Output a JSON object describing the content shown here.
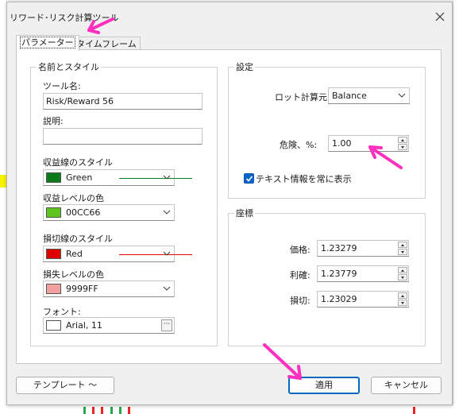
{
  "window": {
    "title": "リワード･リスク計算ツール"
  },
  "tabs": [
    {
      "label": "パラメーター",
      "active": true
    },
    {
      "label": "タイムフレーム",
      "active": false
    }
  ],
  "name_style": {
    "legend": "名前とスタイル",
    "tool_name_label": "ツール名:",
    "tool_name_value": "Risk/Reward 56",
    "description_label": "説明:",
    "description_value": "",
    "profit_line_label": "収益線のスタイル",
    "profit_line_color_name": "Green",
    "profit_line_color": "#0b7a1a",
    "profit_level_label": "収益レベルの色",
    "profit_level_color_name": "00CC66",
    "profit_level_color": "#5ec51e",
    "stop_line_label": "損切線のスタイル",
    "stop_line_color_name": "Red",
    "stop_line_color": "#e00000",
    "loss_level_label": "損失レベルの色",
    "loss_level_color_name": "9999FF",
    "loss_level_color": "#f2a0a0",
    "font_label": "フォント:",
    "font_value": "Arial, 11"
  },
  "settings": {
    "legend": "設定",
    "lot_calc_label": "ロット計算元",
    "lot_calc_value": "Balance",
    "risk_label": "危険、%:",
    "risk_value": "1.00",
    "show_text_label": "テキスト情報を常に表示",
    "show_text_checked": true
  },
  "coords": {
    "legend": "座標",
    "price_label": "価格:",
    "price_value": "1.23279",
    "take_profit_label": "利確:",
    "take_profit_value": "1.23779",
    "stop_loss_label": "損切:",
    "stop_loss_value": "1.23029"
  },
  "buttons": {
    "template": "テンプレート ～",
    "apply": "適用",
    "cancel": "キャンセル"
  },
  "annotation_color": "#ff2fbf"
}
